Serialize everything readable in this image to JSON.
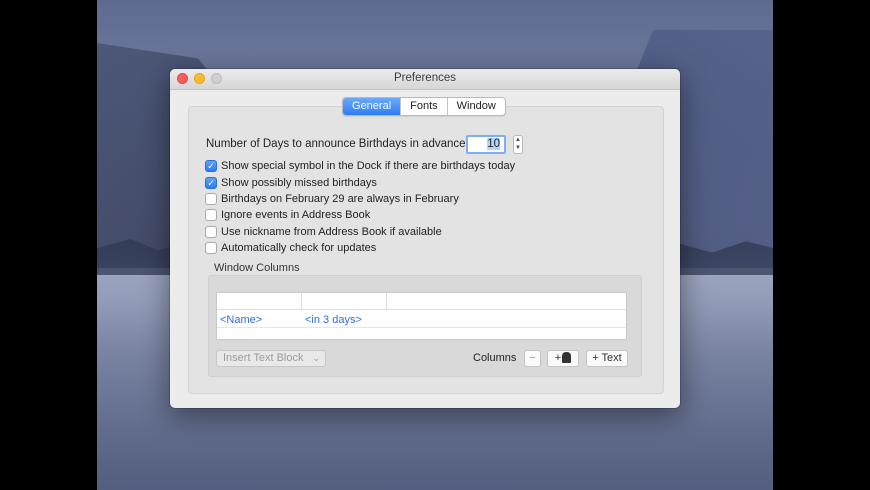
{
  "window": {
    "title": "Preferences"
  },
  "tabs": [
    {
      "label": "General",
      "active": true
    },
    {
      "label": "Fonts",
      "active": false
    },
    {
      "label": "Window",
      "active": false
    }
  ],
  "general": {
    "days_label": "Number of Days to announce Birthdays in advance:",
    "days_value": "10",
    "checkboxes": [
      {
        "label": "Show special symbol in the Dock if there are birthdays today",
        "checked": true
      },
      {
        "label": "Show possibly missed birthdays",
        "checked": true
      },
      {
        "label": "Birthdays on February 29 are always in February",
        "checked": false
      },
      {
        "label": "Ignore events in Address Book",
        "checked": false
      },
      {
        "label": "Use nickname from Address Book if available",
        "checked": false
      },
      {
        "label": "Automatically check for updates",
        "checked": false
      }
    ],
    "window_columns_label": "Window Columns",
    "columns_table": {
      "cells": [
        "<Name>",
        "<in 3 days>"
      ]
    },
    "insert_text_block": "Insert Text Block",
    "columns_label": "Columns",
    "minus_label": "−",
    "plus_person_label": "+",
    "plus_text_label": "+ Text"
  },
  "colors": {
    "accent": "#2f7cf6",
    "link": "#2f6fd6"
  }
}
